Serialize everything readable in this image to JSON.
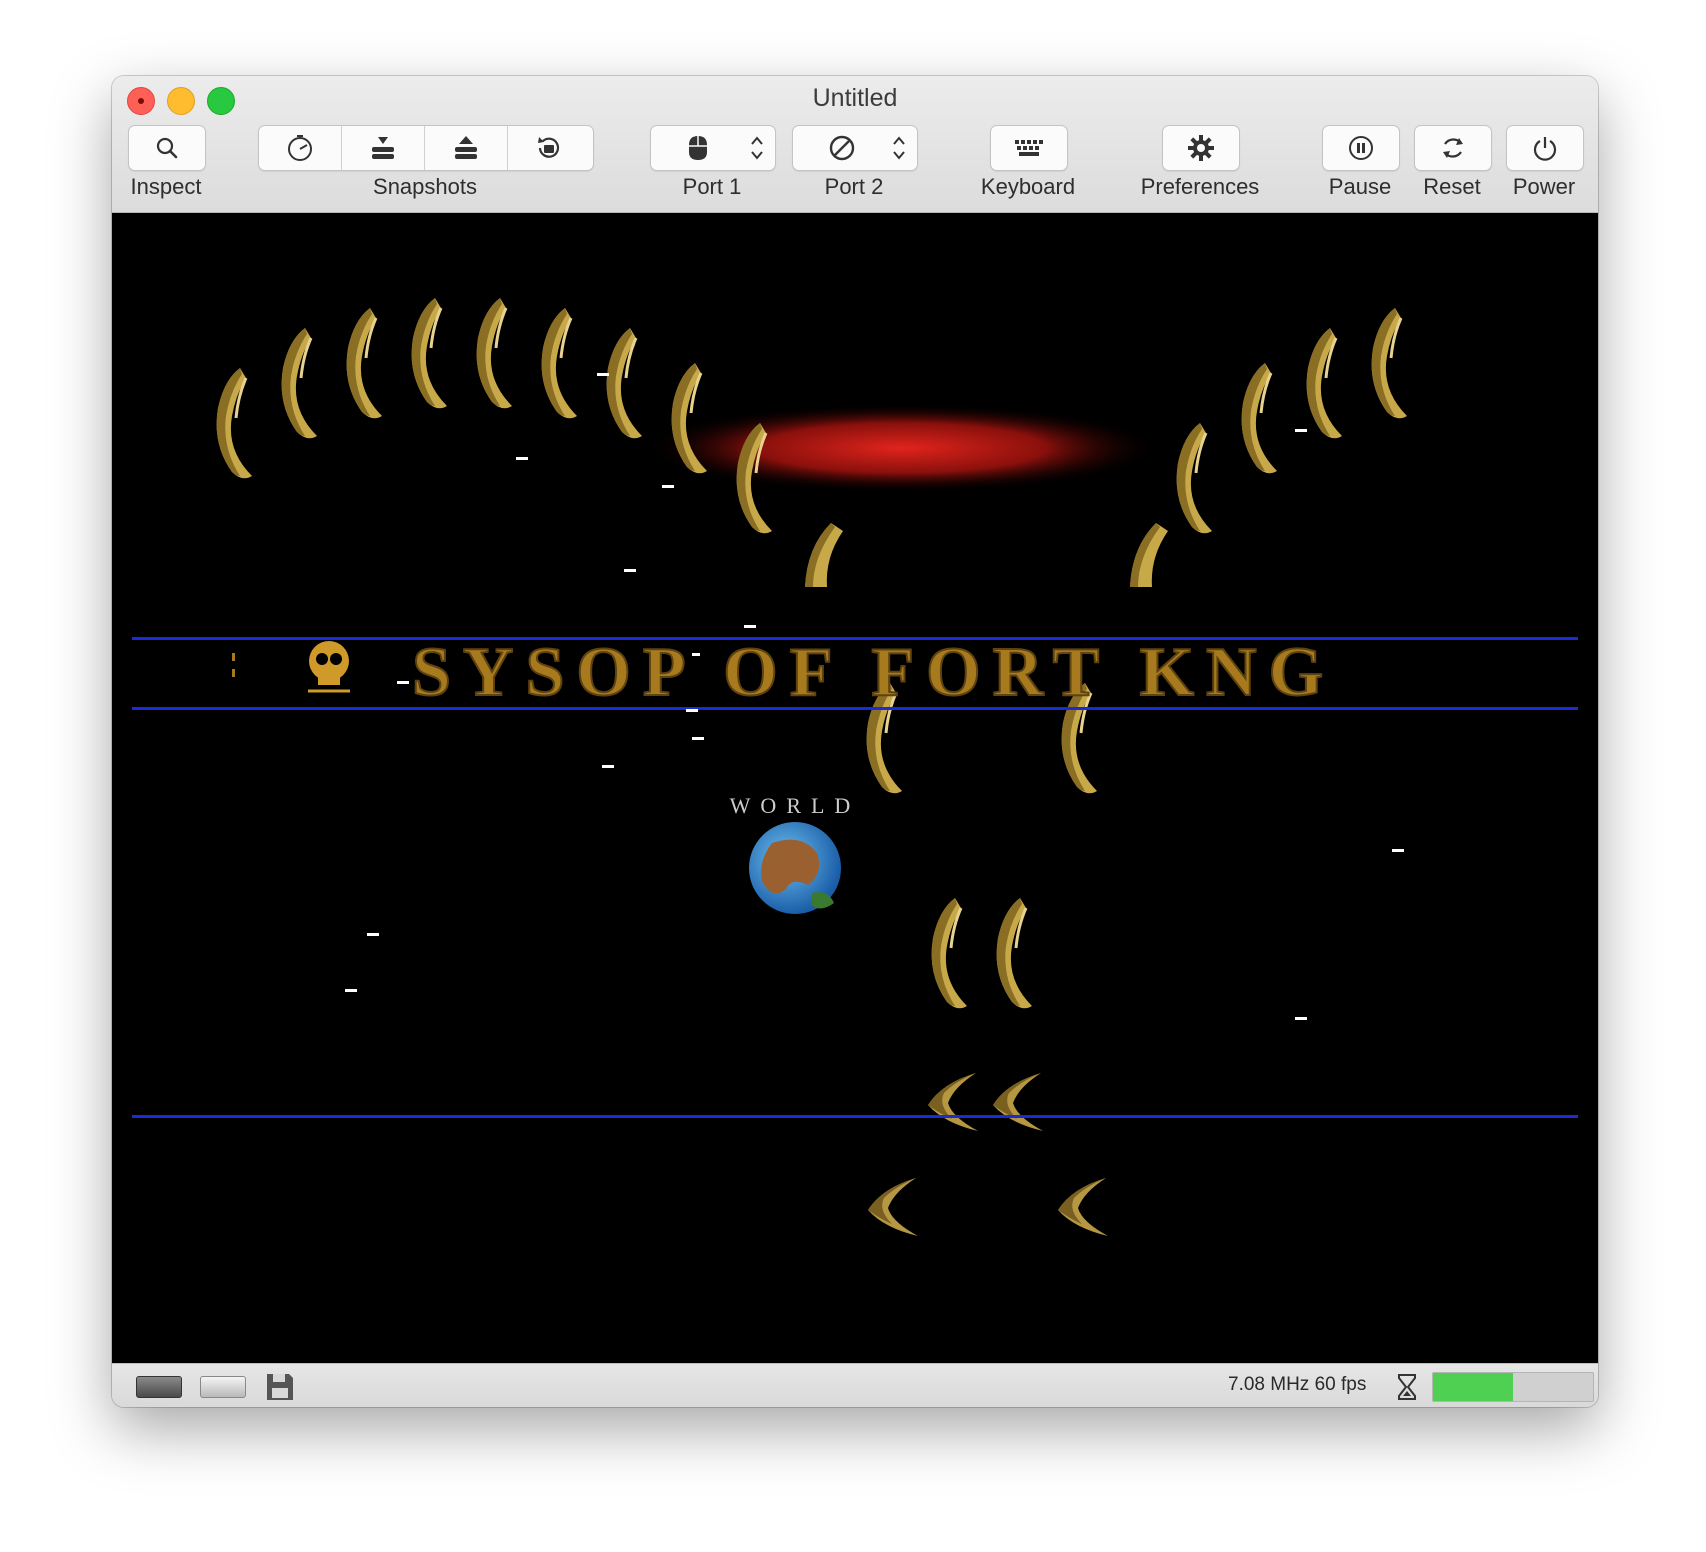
{
  "window": {
    "title": "Untitled"
  },
  "toolbar": {
    "inspect_label": "Inspect",
    "snapshots_label": "Snapshots",
    "port1_label": "Port 1",
    "port2_label": "Port 2",
    "keyboard_label": "Keyboard",
    "preferences_label": "Preferences",
    "pause_label": "Pause",
    "reset_label": "Reset",
    "power_label": "Power"
  },
  "screen": {
    "banner_text": "SYSOP OF FORT KNG",
    "globe_text": "WORLD",
    "colors": {
      "banana": "#c8a94a",
      "rule": "#1a2cd8",
      "banner": "#a87a1e",
      "glow": "#e0241c"
    }
  },
  "status": {
    "speed_text": "7.08 MHz 60 fps",
    "meter_fraction": 0.5,
    "meter_color": "#4fd052"
  },
  "icons": [
    "magnifier-icon",
    "snapshot-take-icon",
    "snapshot-stack-icon",
    "snapshot-eject-icon",
    "snapshot-restore-icon",
    "mouse-icon",
    "none-icon",
    "keyboard-icon",
    "gear-icon",
    "pause-icon",
    "reset-icon",
    "power-icon",
    "hourglass-icon",
    "floppy-icon"
  ]
}
